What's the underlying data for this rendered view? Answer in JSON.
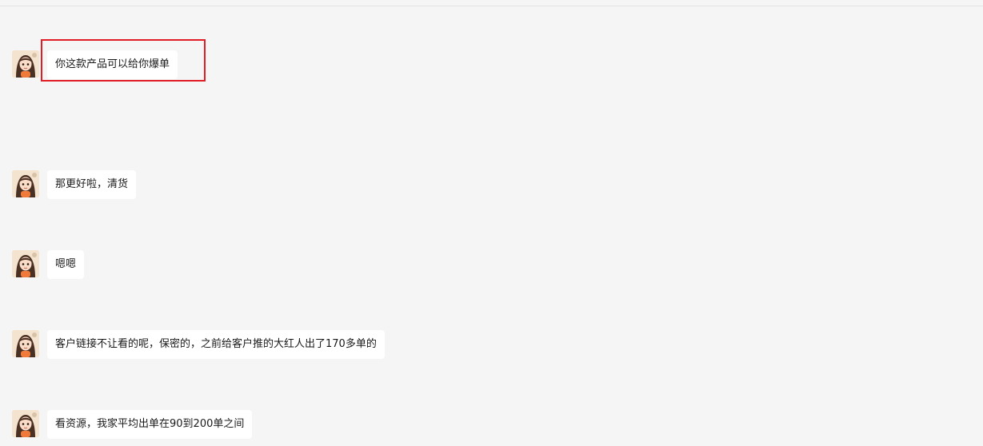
{
  "messages": [
    {
      "text": "你这款产品可以给你爆单",
      "avatar": "girl-avatar"
    },
    {
      "text": "那更好啦，清货",
      "avatar": "girl-avatar"
    },
    {
      "text": "嗯嗯",
      "avatar": "girl-avatar"
    },
    {
      "text": "客户链接不让看的呢，保密的，之前给客户推的大红人出了170多单的",
      "avatar": "girl-avatar"
    },
    {
      "text": "看资源，我家平均出单在90到200单之间",
      "avatar": "girl-avatar"
    }
  ],
  "colors": {
    "background": "#f5f5f5",
    "bubble": "#ffffff",
    "highlight": "#e21c24"
  }
}
